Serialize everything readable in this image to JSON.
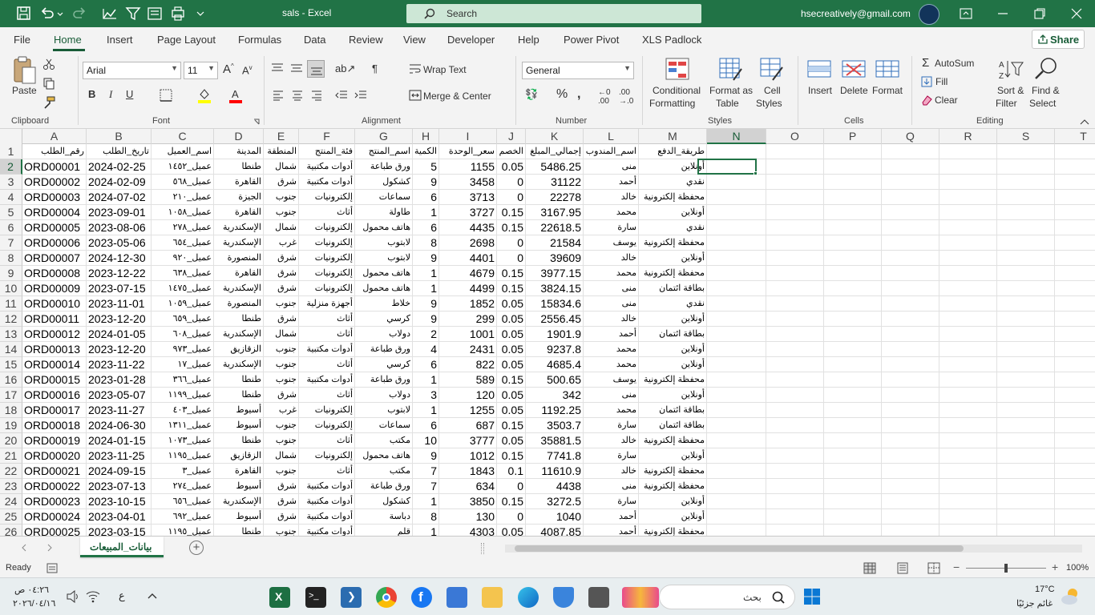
{
  "titlebar": {
    "doc_title": "sals  -  Excel",
    "search_placeholder": "Search",
    "user_email": "hsecreatively@gmail.com"
  },
  "menu": {
    "tabs": [
      "File",
      "Home",
      "Insert",
      "Page Layout",
      "Formulas",
      "Data",
      "Review",
      "View",
      "Developer",
      "Help",
      "Power Pivot",
      "XLS Padlock"
    ],
    "active": "Home",
    "share": "Share"
  },
  "ribbon": {
    "clipboard": {
      "paste": "Paste",
      "label": "Clipboard"
    },
    "font": {
      "name": "Arial",
      "size": "11",
      "label": "Font"
    },
    "alignment": {
      "wrap_text": "Wrap Text",
      "merge_center": "Merge & Center",
      "label": "Alignment"
    },
    "number": {
      "format": "General",
      "label": "Number"
    },
    "styles": {
      "conditional": "Conditional",
      "conditional2": "Formatting",
      "format_as": "Format as",
      "format_as2": "Table",
      "cell": "Cell",
      "cell2": "Styles",
      "label": "Styles"
    },
    "cells": {
      "insert": "Insert",
      "delete": "Delete",
      "format": "Format",
      "label": "Cells"
    },
    "editing": {
      "autosum": "AutoSum",
      "fill": "Fill",
      "clear": "Clear",
      "sort": "Sort &",
      "sort2": "Filter",
      "find": "Find &",
      "find2": "Select",
      "label": "Editing"
    }
  },
  "sheet": {
    "columns": [
      "A",
      "B",
      "C",
      "D",
      "E",
      "F",
      "G",
      "H",
      "I",
      "J",
      "K",
      "L",
      "M",
      "N",
      "O",
      "P",
      "Q",
      "R",
      "S",
      "T"
    ],
    "selected_column": "N",
    "selected_row": "2",
    "header_row": [
      "رقم_الطلب",
      "تاريخ_الطلب",
      "اسم_العميل",
      "المدينة",
      "المنطقة",
      "فئة_المنتج",
      "اسم_المنتج",
      "الكمية",
      "سعر_الوحدة",
      "الخصم",
      "إجمالي_المبلغ",
      "اسم_المندوب",
      "طريقة_الدفع"
    ],
    "rows": [
      [
        "ORD00001",
        "2024-02-25",
        "عميل_١٤٥٢",
        "طنطا",
        "شمال",
        "أدوات مكتبية",
        "ورق طباعة",
        "5",
        "1155",
        "0.05",
        "5486.25",
        "منى",
        "أونلاين"
      ],
      [
        "ORD00002",
        "2024-02-09",
        "عميل_٥٦٨",
        "القاهرة",
        "شرق",
        "أدوات مكتبية",
        "كشكول",
        "9",
        "3458",
        "0",
        "31122",
        "أحمد",
        "نقدي"
      ],
      [
        "ORD00003",
        "2024-07-02",
        "عميل_٢١٠",
        "الجيزة",
        "جنوب",
        "إلكترونيات",
        "سماعات",
        "6",
        "3713",
        "0",
        "22278",
        "خالد",
        "محفظة إلكترونية"
      ],
      [
        "ORD00004",
        "2023-09-01",
        "عميل_١٠٥٨",
        "القاهرة",
        "جنوب",
        "أثاث",
        "طاولة",
        "1",
        "3727",
        "0.15",
        "3167.95",
        "محمد",
        "أونلاين"
      ],
      [
        "ORD00005",
        "2023-08-06",
        "عميل_٢٧٨",
        "الإسكندرية",
        "شمال",
        "إلكترونيات",
        "هاتف محمول",
        "6",
        "4435",
        "0.15",
        "22618.5",
        "سارة",
        "نقدي"
      ],
      [
        "ORD00006",
        "2023-05-06",
        "عميل_٦٥٤",
        "الإسكندرية",
        "غرب",
        "إلكترونيات",
        "لابتوب",
        "8",
        "2698",
        "0",
        "21584",
        "يوسف",
        "محفظة إلكترونية"
      ],
      [
        "ORD00007",
        "2024-12-30",
        "عميل_٩٢٠",
        "المنصورة",
        "شرق",
        "إلكترونيات",
        "لابتوب",
        "9",
        "4401",
        "0",
        "39609",
        "خالد",
        "أونلاين"
      ],
      [
        "ORD00008",
        "2023-12-22",
        "عميل_٦٣٨",
        "القاهرة",
        "شرق",
        "إلكترونيات",
        "هاتف محمول",
        "1",
        "4679",
        "0.15",
        "3977.15",
        "محمد",
        "محفظة إلكترونية"
      ],
      [
        "ORD00009",
        "2023-07-15",
        "عميل_١٤٧٥",
        "الإسكندرية",
        "شرق",
        "إلكترونيات",
        "هاتف محمول",
        "1",
        "4499",
        "0.15",
        "3824.15",
        "منى",
        "بطاقة ائتمان"
      ],
      [
        "ORD00010",
        "2023-11-01",
        "عميل_١٠٥٩",
        "المنصورة",
        "جنوب",
        "أجهزة منزلية",
        "خلاط",
        "9",
        "1852",
        "0.05",
        "15834.6",
        "منى",
        "نقدي"
      ],
      [
        "ORD00011",
        "2023-12-20",
        "عميل_٦٥٩",
        "طنطا",
        "شرق",
        "أثاث",
        "كرسي",
        "9",
        "299",
        "0.05",
        "2556.45",
        "خالد",
        "أونلاين"
      ],
      [
        "ORD00012",
        "2024-01-05",
        "عميل_٦٠٨",
        "الإسكندرية",
        "شمال",
        "أثاث",
        "دولاب",
        "2",
        "1001",
        "0.05",
        "1901.9",
        "أحمد",
        "بطاقة ائتمان"
      ],
      [
        "ORD00013",
        "2023-12-20",
        "عميل_٩٧٣",
        "الزقازيق",
        "جنوب",
        "أدوات مكتبية",
        "ورق طباعة",
        "4",
        "2431",
        "0.05",
        "9237.8",
        "محمد",
        "أونلاين"
      ],
      [
        "ORD00014",
        "2023-11-22",
        "عميل_١٧",
        "الإسكندرية",
        "جنوب",
        "أثاث",
        "كرسي",
        "6",
        "822",
        "0.05",
        "4685.4",
        "محمد",
        "أونلاين"
      ],
      [
        "ORD00015",
        "2023-01-28",
        "عميل_٣٦٦",
        "طنطا",
        "جنوب",
        "أدوات مكتبية",
        "ورق طباعة",
        "1",
        "589",
        "0.15",
        "500.65",
        "يوسف",
        "محفظة إلكترونية"
      ],
      [
        "ORD00016",
        "2023-05-07",
        "عميل_١١٩٩",
        "طنطا",
        "شرق",
        "أثاث",
        "دولاب",
        "3",
        "120",
        "0.05",
        "342",
        "منى",
        "أونلاين"
      ],
      [
        "ORD00017",
        "2023-11-27",
        "عميل_٤٠٣",
        "أسيوط",
        "غرب",
        "إلكترونيات",
        "لابتوب",
        "1",
        "1255",
        "0.05",
        "1192.25",
        "محمد",
        "بطاقة ائتمان"
      ],
      [
        "ORD00018",
        "2024-06-30",
        "عميل_١٣١١",
        "أسيوط",
        "جنوب",
        "إلكترونيات",
        "سماعات",
        "6",
        "687",
        "0.15",
        "3503.7",
        "سارة",
        "بطاقة ائتمان"
      ],
      [
        "ORD00019",
        "2024-01-15",
        "عميل_١٠٧٣",
        "طنطا",
        "جنوب",
        "أثاث",
        "مكتب",
        "10",
        "3777",
        "0.05",
        "35881.5",
        "خالد",
        "محفظة إلكترونية"
      ],
      [
        "ORD00020",
        "2023-11-25",
        "عميل_١١٩٥",
        "الزقازيق",
        "شمال",
        "إلكترونيات",
        "هاتف محمول",
        "9",
        "1012",
        "0.15",
        "7741.8",
        "سارة",
        "أونلاين"
      ],
      [
        "ORD00021",
        "2024-09-15",
        "عميل_٣",
        "القاهرة",
        "جنوب",
        "أثاث",
        "مكتب",
        "7",
        "1843",
        "0.1",
        "11610.9",
        "خالد",
        "محفظة إلكترونية"
      ],
      [
        "ORD00022",
        "2023-07-13",
        "عميل_٢٧٤",
        "أسيوط",
        "شرق",
        "أدوات مكتبية",
        "ورق طباعة",
        "7",
        "634",
        "0",
        "4438",
        "منى",
        "محفظة إلكترونية"
      ],
      [
        "ORD00023",
        "2023-10-15",
        "عميل_٦٥٦",
        "الإسكندرية",
        "شرق",
        "أدوات مكتبية",
        "كشكول",
        "1",
        "3850",
        "0.15",
        "3272.5",
        "سارة",
        "أونلاين"
      ],
      [
        "ORD00024",
        "2023-04-01",
        "عميل_٦٩٢",
        "أسيوط",
        "شرق",
        "أدوات مكتبية",
        "دباسة",
        "8",
        "130",
        "0",
        "1040",
        "أحمد",
        "أونلاين"
      ],
      [
        "ORD00025",
        "2023-03-15",
        "عميل_١١٩٥",
        "طنطا",
        "جنوب",
        "أدوات مكتبية",
        "قلم",
        "1",
        "4303",
        "0.05",
        "4087.85",
        "أحمد",
        "محفظة إلكترونية"
      ]
    ]
  },
  "sheet_tab": "بيانات_المبيعات",
  "status": {
    "ready": "Ready",
    "zoom": "100%"
  },
  "taskbar": {
    "search": "بحث",
    "time": "٠٤:٢٦ ص",
    "date": "٢٠٢٦/٠٤/١٦",
    "weather_temp": "17°C",
    "weather_desc": "غائم جزئيًا",
    "lang": "ع"
  },
  "colors": {
    "excel_green": "#217346",
    "accent_dark": "#185c37"
  }
}
